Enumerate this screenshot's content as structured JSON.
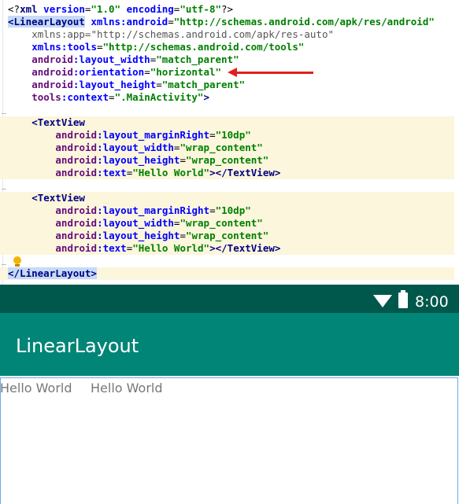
{
  "editor": {
    "lines": [
      {
        "segments": [
          {
            "t": "<?",
            "c": "tok-pi"
          },
          {
            "t": "xml ",
            "c": "tok-tag"
          },
          {
            "t": "version",
            "c": "tok-attr"
          },
          {
            "t": "=",
            "c": "tok-plain"
          },
          {
            "t": "\"1.0\"",
            "c": "tok-val"
          },
          {
            "t": " ",
            "c": "tok-plain"
          },
          {
            "t": "encoding",
            "c": "tok-attr"
          },
          {
            "t": "=",
            "c": "tok-plain"
          },
          {
            "t": "\"utf-8\"",
            "c": "tok-val"
          },
          {
            "t": "?>",
            "c": "tok-pi"
          }
        ]
      },
      {
        "segments": [
          {
            "t": "<LinearLayout",
            "c": "tok-tag tag-sel"
          },
          {
            "t": " ",
            "c": "tok-plain"
          },
          {
            "t": "xmlns:android",
            "c": "tok-ns-plain"
          },
          {
            "t": "=",
            "c": "tok-plain"
          },
          {
            "t": "\"http://schemas.android.com/apk/res/android\"",
            "c": "tok-val"
          }
        ]
      },
      {
        "indent": 4,
        "segments": [
          {
            "t": "xmlns:app",
            "c": "tok-gray"
          },
          {
            "t": "=",
            "c": "tok-gray"
          },
          {
            "t": "\"http://schemas.android.com/apk/res-auto\"",
            "c": "tok-gray"
          }
        ]
      },
      {
        "indent": 4,
        "segments": [
          {
            "t": "xmlns:tools",
            "c": "tok-ns-plain"
          },
          {
            "t": "=",
            "c": "tok-plain"
          },
          {
            "t": "\"http://schemas.android.com/tools\"",
            "c": "tok-val"
          }
        ]
      },
      {
        "indent": 4,
        "segments": [
          {
            "t": "android",
            "c": "tok-ns"
          },
          {
            "t": ":layout_width",
            "c": "tok-attr"
          },
          {
            "t": "=",
            "c": "tok-plain"
          },
          {
            "t": "\"match_parent\"",
            "c": "tok-val"
          }
        ]
      },
      {
        "indent": 4,
        "segments": [
          {
            "t": "android",
            "c": "tok-ns"
          },
          {
            "t": ":orientation",
            "c": "tok-attr"
          },
          {
            "t": "=",
            "c": "tok-plain"
          },
          {
            "t": "\"horizontal\"",
            "c": "tok-val"
          }
        ]
      },
      {
        "indent": 4,
        "segments": [
          {
            "t": "android",
            "c": "tok-ns"
          },
          {
            "t": ":layout_height",
            "c": "tok-attr"
          },
          {
            "t": "=",
            "c": "tok-plain"
          },
          {
            "t": "\"match_parent\"",
            "c": "tok-val"
          }
        ]
      },
      {
        "indent": 4,
        "segments": [
          {
            "t": "tools",
            "c": "tok-ns"
          },
          {
            "t": ":context",
            "c": "tok-attr"
          },
          {
            "t": "=",
            "c": "tok-plain"
          },
          {
            "t": "\".MainActivity\"",
            "c": "tok-val"
          },
          {
            "t": ">",
            "c": "tok-tag"
          }
        ]
      },
      {
        "segments": []
      },
      {
        "indent": 4,
        "hl": "yellow",
        "segments": [
          {
            "t": "<TextView",
            "c": "tok-tag"
          }
        ]
      },
      {
        "indent": 8,
        "hl": "yellow",
        "segments": [
          {
            "t": "android",
            "c": "tok-ns"
          },
          {
            "t": ":layout_marginRight",
            "c": "tok-attr"
          },
          {
            "t": "=",
            "c": "tok-plain"
          },
          {
            "t": "\"10dp\"",
            "c": "tok-val"
          }
        ]
      },
      {
        "indent": 8,
        "hl": "yellow",
        "segments": [
          {
            "t": "android",
            "c": "tok-ns"
          },
          {
            "t": ":layout_width",
            "c": "tok-attr"
          },
          {
            "t": "=",
            "c": "tok-plain"
          },
          {
            "t": "\"wrap_content\"",
            "c": "tok-val"
          }
        ]
      },
      {
        "indent": 8,
        "hl": "yellow",
        "segments": [
          {
            "t": "android",
            "c": "tok-ns"
          },
          {
            "t": ":layout_height",
            "c": "tok-attr"
          },
          {
            "t": "=",
            "c": "tok-plain"
          },
          {
            "t": "\"wrap_content\"",
            "c": "tok-val"
          }
        ]
      },
      {
        "indent": 8,
        "hl": "yellow",
        "segments": [
          {
            "t": "android",
            "c": "tok-ns"
          },
          {
            "t": ":text",
            "c": "tok-attr"
          },
          {
            "t": "=",
            "c": "tok-plain"
          },
          {
            "t": "\"Hello World\"",
            "c": "tok-val"
          },
          {
            "t": "></",
            "c": "tok-tag"
          },
          {
            "t": "TextView",
            "c": "tok-tag"
          },
          {
            "t": ">",
            "c": "tok-tag"
          }
        ]
      },
      {
        "segments": []
      },
      {
        "indent": 4,
        "hl": "yellow",
        "segments": [
          {
            "t": "<TextView",
            "c": "tok-tag"
          }
        ]
      },
      {
        "indent": 8,
        "hl": "yellow",
        "segments": [
          {
            "t": "android",
            "c": "tok-ns"
          },
          {
            "t": ":layout_marginRight",
            "c": "tok-attr"
          },
          {
            "t": "=",
            "c": "tok-plain"
          },
          {
            "t": "\"10dp\"",
            "c": "tok-val"
          }
        ]
      },
      {
        "indent": 8,
        "hl": "yellow",
        "segments": [
          {
            "t": "android",
            "c": "tok-ns"
          },
          {
            "t": ":layout_width",
            "c": "tok-attr"
          },
          {
            "t": "=",
            "c": "tok-plain"
          },
          {
            "t": "\"wrap_content\"",
            "c": "tok-val"
          }
        ]
      },
      {
        "indent": 8,
        "hl": "yellow",
        "segments": [
          {
            "t": "android",
            "c": "tok-ns"
          },
          {
            "t": ":layout_height",
            "c": "tok-attr"
          },
          {
            "t": "=",
            "c": "tok-plain"
          },
          {
            "t": "\"wrap_content\"",
            "c": "tok-val"
          }
        ]
      },
      {
        "indent": 8,
        "hl": "yellow",
        "segments": [
          {
            "t": "android",
            "c": "tok-ns"
          },
          {
            "t": ":text",
            "c": "tok-attr"
          },
          {
            "t": "=",
            "c": "tok-plain"
          },
          {
            "t": "\"Hello World\"",
            "c": "tok-val"
          },
          {
            "t": "></",
            "c": "tok-tag"
          },
          {
            "t": "TextView",
            "c": "tok-tag"
          },
          {
            "t": ">",
            "c": "tok-tag"
          }
        ]
      },
      {
        "segments": []
      },
      {
        "hl": "yellow",
        "segments": [
          {
            "t": "</LinearLayout>",
            "c": "tok-tag tag-sel"
          }
        ]
      }
    ]
  },
  "device": {
    "status_time": "8:00",
    "app_title": "LinearLayout",
    "textviews": [
      "Hello World",
      "Hello World"
    ]
  },
  "colors": {
    "status_bar": "#00574b",
    "app_bar": "#008577",
    "annotation_arrow": "#e02020"
  },
  "icons": [
    "wifi-icon",
    "battery-icon",
    "lightbulb-icon",
    "arrow-left-icon"
  ]
}
